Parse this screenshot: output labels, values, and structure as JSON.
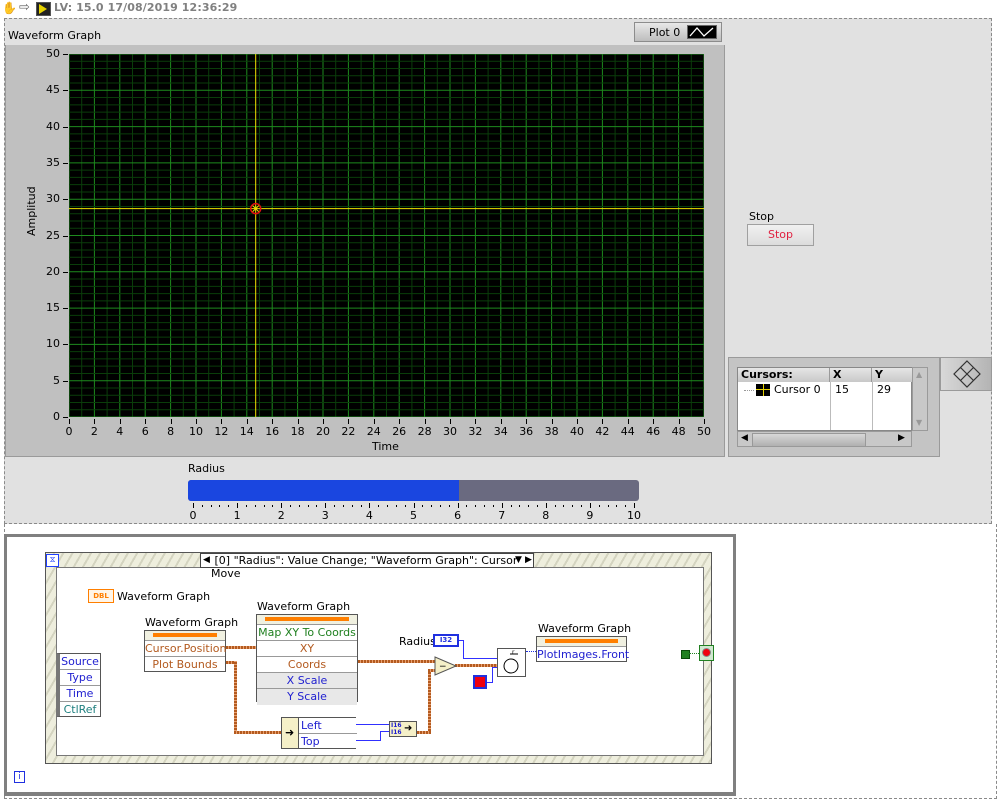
{
  "toolbar": {
    "icons": [
      "hand-tool-icon",
      "forward-arrow-icon",
      "labview-vi-icon"
    ],
    "version_text": "LV: 15.0 17/08/2019 12:36:29"
  },
  "front_panel": {
    "graph": {
      "label": "Waveform Graph",
      "legend_plot_label": "Plot 0",
      "x_axis_title": "Time",
      "y_axis_title": "Amplitud",
      "colors": {
        "plot_bg": "#000000",
        "grid_major": "#1e8a1e",
        "grid_minor": "#0a3d0a",
        "cursor": "#f0e000"
      }
    },
    "stop": {
      "label": "Stop",
      "button_text": "Stop",
      "text_color": "#e02040"
    },
    "cursor_legend": {
      "headers": [
        "Cursors:",
        "X",
        "Y"
      ],
      "rows": [
        {
          "name": "Cursor 0",
          "x": "15",
          "y": "29"
        }
      ]
    },
    "radius": {
      "label": "Radius",
      "value": 6,
      "min": 0,
      "max": 10,
      "ticks": [
        "0",
        "1",
        "2",
        "3",
        "4",
        "5",
        "6",
        "7",
        "8",
        "9",
        "10"
      ],
      "fill_color": "#1a46e0"
    }
  },
  "chart_data": {
    "type": "line",
    "title": "Waveform Graph",
    "xlabel": "Time",
    "ylabel": "Amplitud",
    "xlim": [
      0,
      50
    ],
    "ylim": [
      0,
      50
    ],
    "x_ticks": [
      "0",
      "2",
      "4",
      "6",
      "8",
      "10",
      "12",
      "14",
      "16",
      "18",
      "20",
      "22",
      "24",
      "26",
      "28",
      "30",
      "32",
      "34",
      "36",
      "38",
      "40",
      "42",
      "44",
      "46",
      "48",
      "50"
    ],
    "y_ticks": [
      "0",
      "5",
      "10",
      "15",
      "20",
      "25",
      "30",
      "35",
      "40",
      "45",
      "50"
    ],
    "grid": true,
    "legend": "top-right",
    "series": [
      {
        "name": "Plot 0",
        "values": []
      }
    ],
    "cursors": [
      {
        "name": "Cursor 0",
        "x": 14.7,
        "y": 28.7
      }
    ]
  },
  "block_diagram": {
    "event_selector": "[0] \"Radius\": Value Change;  \"Waveform Graph\": Cursor Move",
    "dbl_ref_label": "Waveform Graph",
    "dbl_tag": "DBL",
    "event_data": [
      "Source",
      "Type",
      "Time",
      "CtlRef"
    ],
    "prop_node_1": {
      "title": "Waveform Graph",
      "rows": [
        "Cursor.Position",
        "Plot Bounds"
      ]
    },
    "invoke_node": {
      "title": "Waveform Graph",
      "method": "Map XY To Coords",
      "rows": [
        "XY",
        "Coords",
        "X Scale",
        "Y Scale"
      ]
    },
    "unbundle": {
      "rows": [
        "Left",
        "Top"
      ]
    },
    "radius_terminal": {
      "label": "Radius",
      "tag": "I32"
    },
    "prop_node_2": {
      "title": "Waveform Graph",
      "rows": [
        "PlotImages.Front"
      ]
    },
    "info_icon": "i"
  }
}
